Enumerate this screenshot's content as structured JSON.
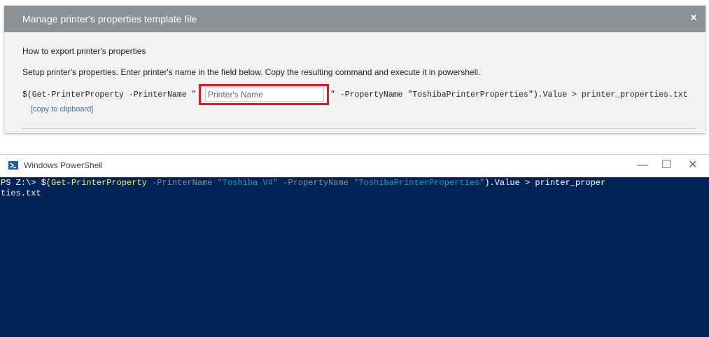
{
  "dialog": {
    "title": "Manage printer's properties template file",
    "close_icon": "×",
    "heading": "How to export printer's properties",
    "instructions": "Setup printer's properties. Enter printer's name in the field below. Copy the resulting command and execute it in powershell.",
    "cmd_prefix": "$(Get-PrinterProperty -PrinterName \"",
    "name_placeholder": "Printer's Name",
    "name_value": "",
    "cmd_suffix": "\" -PropertyName \"ToshibaPrinterProperties\").Value > printer_properties.txt",
    "copy_label": "[copy to clipboard]",
    "accent": "#e8151a"
  },
  "powershell": {
    "title": "Windows PowerShell",
    "minimize": "—",
    "maximize": "☐",
    "close": "✕",
    "prompt": "PS Z:\\> ",
    "t1": "$(",
    "t2": "Get-PrinterProperty",
    "t3": " -PrinterName ",
    "t4": "\"Toshiba V4\"",
    "t5": " -PropertyName ",
    "t6": "\"ToshibaPrinterProperties\"",
    "t7": ").Value > printer_proper",
    "line2": "ties.txt",
    "background": "#012456"
  }
}
